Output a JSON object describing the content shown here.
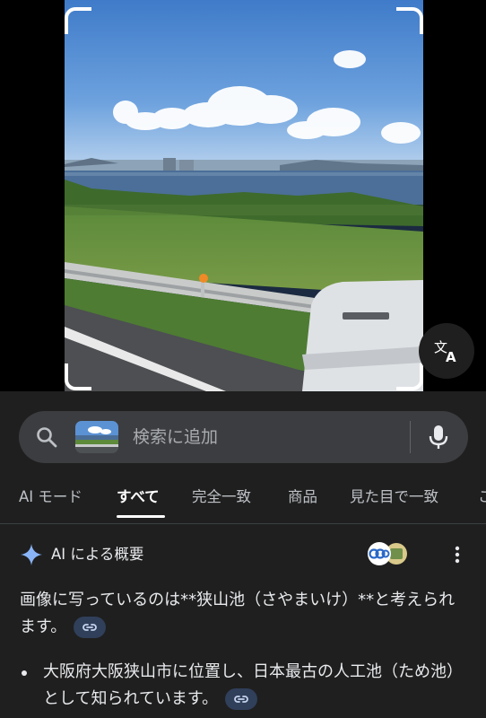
{
  "search": {
    "placeholder": "検索に追加"
  },
  "tabs": [
    {
      "label": "AI モード",
      "active": false
    },
    {
      "label": "すべて",
      "active": true
    },
    {
      "label": "完全一致",
      "active": false
    },
    {
      "label": "商品",
      "active": false
    },
    {
      "label": "見た目で一致",
      "active": false
    },
    {
      "label": "こ",
      "active": false
    }
  ],
  "ai_overview": {
    "title": "AI による概要",
    "paragraph": "画像に写っているのは**狭山池（さやまいけ）**と考えられます。",
    "bullets": [
      "大阪府大阪狭山市に位置し、日本最古の人工池（ため池）として知られています。"
    ]
  },
  "icons": {
    "search": "search-icon",
    "mic": "mic-icon",
    "translate": "translate-icon",
    "sparkle": "ai-sparkle-icon",
    "more": "more-vert-icon",
    "link": "link-icon"
  },
  "colors": {
    "sheet_bg": "#1f1f1f",
    "search_bg": "#3c3d40",
    "sparkle": "#8ab4f8",
    "chip_bg": "#303f5a"
  }
}
